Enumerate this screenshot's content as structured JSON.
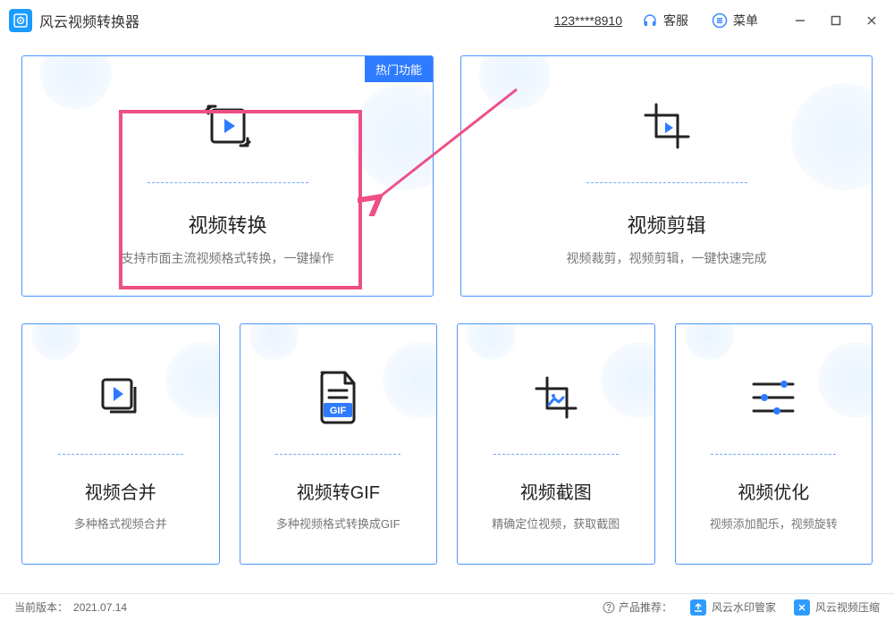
{
  "app": {
    "title": "风云视频转换器"
  },
  "titlebar": {
    "account": "123****8910",
    "support": "客服",
    "menu": "菜单"
  },
  "cards": {
    "convert": {
      "tag": "热门功能",
      "title": "视频转换",
      "subtitle": "支持市面主流视频格式转换，一键操作"
    },
    "edit": {
      "title": "视频剪辑",
      "subtitle": "视频裁剪，视频剪辑，一键快速完成"
    },
    "merge": {
      "title": "视频合并",
      "subtitle": "多种格式视频合并"
    },
    "gif": {
      "title": "视频转GIF",
      "subtitle": "多种视频格式转换成GIF",
      "badge": "GIF"
    },
    "screenshot": {
      "title": "视频截图",
      "subtitle": "精确定位视频，获取截图"
    },
    "optimize": {
      "title": "视频优化",
      "subtitle": "视频添加配乐，视频旋转"
    }
  },
  "footer": {
    "version_label": "当前版本：",
    "version": "2021.07.14",
    "recommend_label": "产品推荐：",
    "rec1": "风云水印管家",
    "rec2": "风云视频压缩"
  }
}
